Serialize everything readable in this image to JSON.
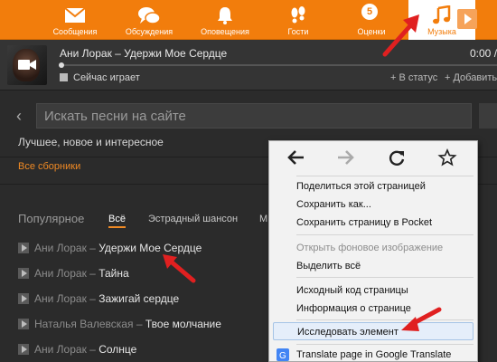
{
  "topnav": {
    "items": [
      {
        "label": "Сообщения",
        "icon": "envelope-icon"
      },
      {
        "label": "Обсуждения",
        "icon": "chat-bubbles-icon"
      },
      {
        "label": "Оповещения",
        "icon": "bell-icon"
      },
      {
        "label": "Гости",
        "icon": "footprints-icon"
      },
      {
        "label": "Оценки",
        "icon": "rating-five-icon",
        "badge": "5"
      },
      {
        "label": "Музыка",
        "icon": "music-note-icon",
        "active": true
      }
    ],
    "colors": {
      "bar": "#f27d0c",
      "active_bg": "#ffffff"
    }
  },
  "player": {
    "track_title": "Ани Лорак – Удержи Мое Сердце",
    "time": "0:00 /",
    "now_playing": "Сейчас играет",
    "status_link": "+ В статус",
    "add_link": "+ Добавить"
  },
  "content": {
    "search_placeholder": "Искать песни на сайте",
    "subtitle": "Лучшее, новое и интересное",
    "all_collections": "Все сборники",
    "popular": "Популярное",
    "tabs": [
      "Всё",
      "Эстрадный шансон",
      "М"
    ],
    "songs": [
      {
        "artist": "Ани Лорак",
        "title": "Удержи Мое Сердце"
      },
      {
        "artist": "Ани Лорак",
        "title": "Тайна"
      },
      {
        "artist": "Ани Лорак",
        "title": "Зажигай сердце"
      },
      {
        "artist": "Наталья Валевская",
        "title": "Твое молчание"
      },
      {
        "artist": "Ани Лорак",
        "title": "Солнце"
      }
    ],
    "separator": "–"
  },
  "context_menu": {
    "nav_icons": [
      "back-arrow-icon",
      "forward-arrow-icon",
      "reload-icon",
      "bookmark-star-icon"
    ],
    "groups": [
      [
        "Поделиться этой страницей",
        "Сохранить как...",
        "Сохранить страницу в Pocket"
      ],
      [
        "Открыть фоновое изображение",
        "Выделить всё"
      ],
      [
        "Исходный код страницы",
        "Информация о странице"
      ],
      [
        "Исследовать элемент"
      ],
      [
        "Translate page in Google Translate"
      ]
    ],
    "disabled": [
      "Открыть фоновое изображение"
    ],
    "highlighted": "Исследовать элемент"
  },
  "annotation_color": "#e02020"
}
